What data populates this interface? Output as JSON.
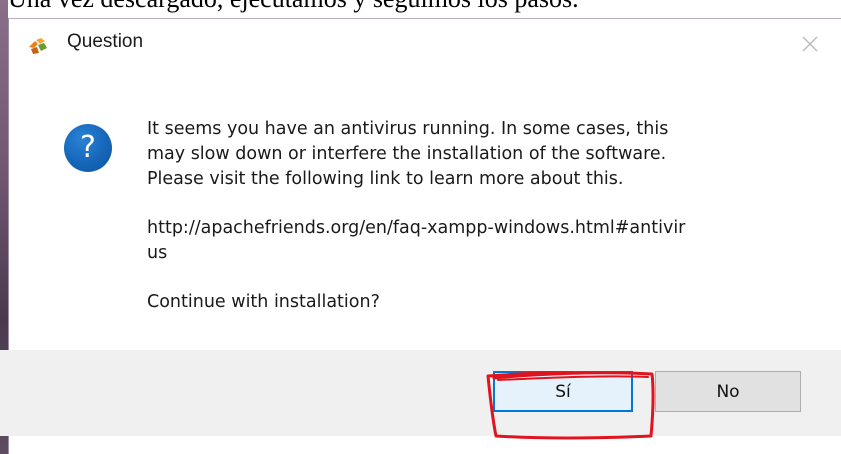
{
  "caption": {
    "text": "Una vez descargado, ejecutamos y seguimos los pasos."
  },
  "dialog": {
    "title": "Question",
    "app_icon": "xampp-icon",
    "close_icon": "close-icon",
    "question_icon": "question-icon",
    "question_glyph": "?",
    "message": {
      "line1": "It seems you have an antivirus running. In some cases, this",
      "line2": "may slow down or interfere the installation of the software.",
      "line3": "Please visit the following link to learn more about this.",
      "link_line1": "http://apachefriends.org/en/faq-xampp-windows.html#antivir",
      "link_line2": "us",
      "prompt": "Continue with installation?"
    },
    "buttons": {
      "yes_label": "Sí",
      "no_label": "No"
    },
    "colors": {
      "accent": "#0078d7",
      "footer": "#f0f0f0",
      "annotation": "#e0141e"
    }
  }
}
